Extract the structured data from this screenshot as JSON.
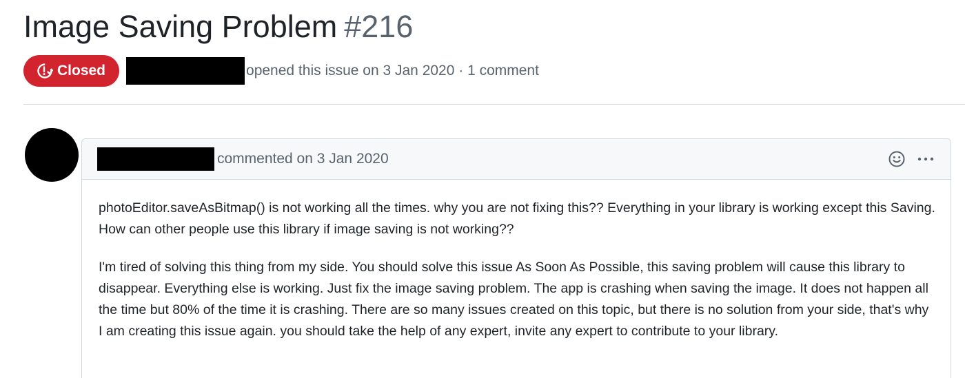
{
  "issue": {
    "title": "Image Saving Problem",
    "number": "#216",
    "state": "Closed",
    "meta": "opened this issue on 3 Jan 2020 · 1 comment"
  },
  "comment": {
    "meta": "commented on 3 Jan 2020",
    "paragraphs": [
      "photoEditor.saveAsBitmap() is not working all the times. why you are not fixing this?? Everything in your library is working except this Saving. How can other people use this library if image saving is not working??",
      "I'm tired of solving this thing from my side. You should solve this issue As Soon As Possible, this saving problem will cause this library to disappear. Everything else is working. Just fix the image saving problem. The app is crashing when saving the image. It does not happen all the time but 80% of the time it is crashing. There are so many issues created on this topic, but there is no solution from your side, that's why I am creating this issue again. you should take the help of any expert, invite any expert to contribute to your library."
    ]
  },
  "icons": {
    "state": "issue-closed-icon",
    "reaction": "smiley-icon",
    "more": "kebab-horizontal-icon"
  },
  "colors": {
    "closed_badge": "#d1242f",
    "muted_text": "#59636e",
    "border": "#d1d9e0",
    "header_bg": "#f6f8fa"
  }
}
